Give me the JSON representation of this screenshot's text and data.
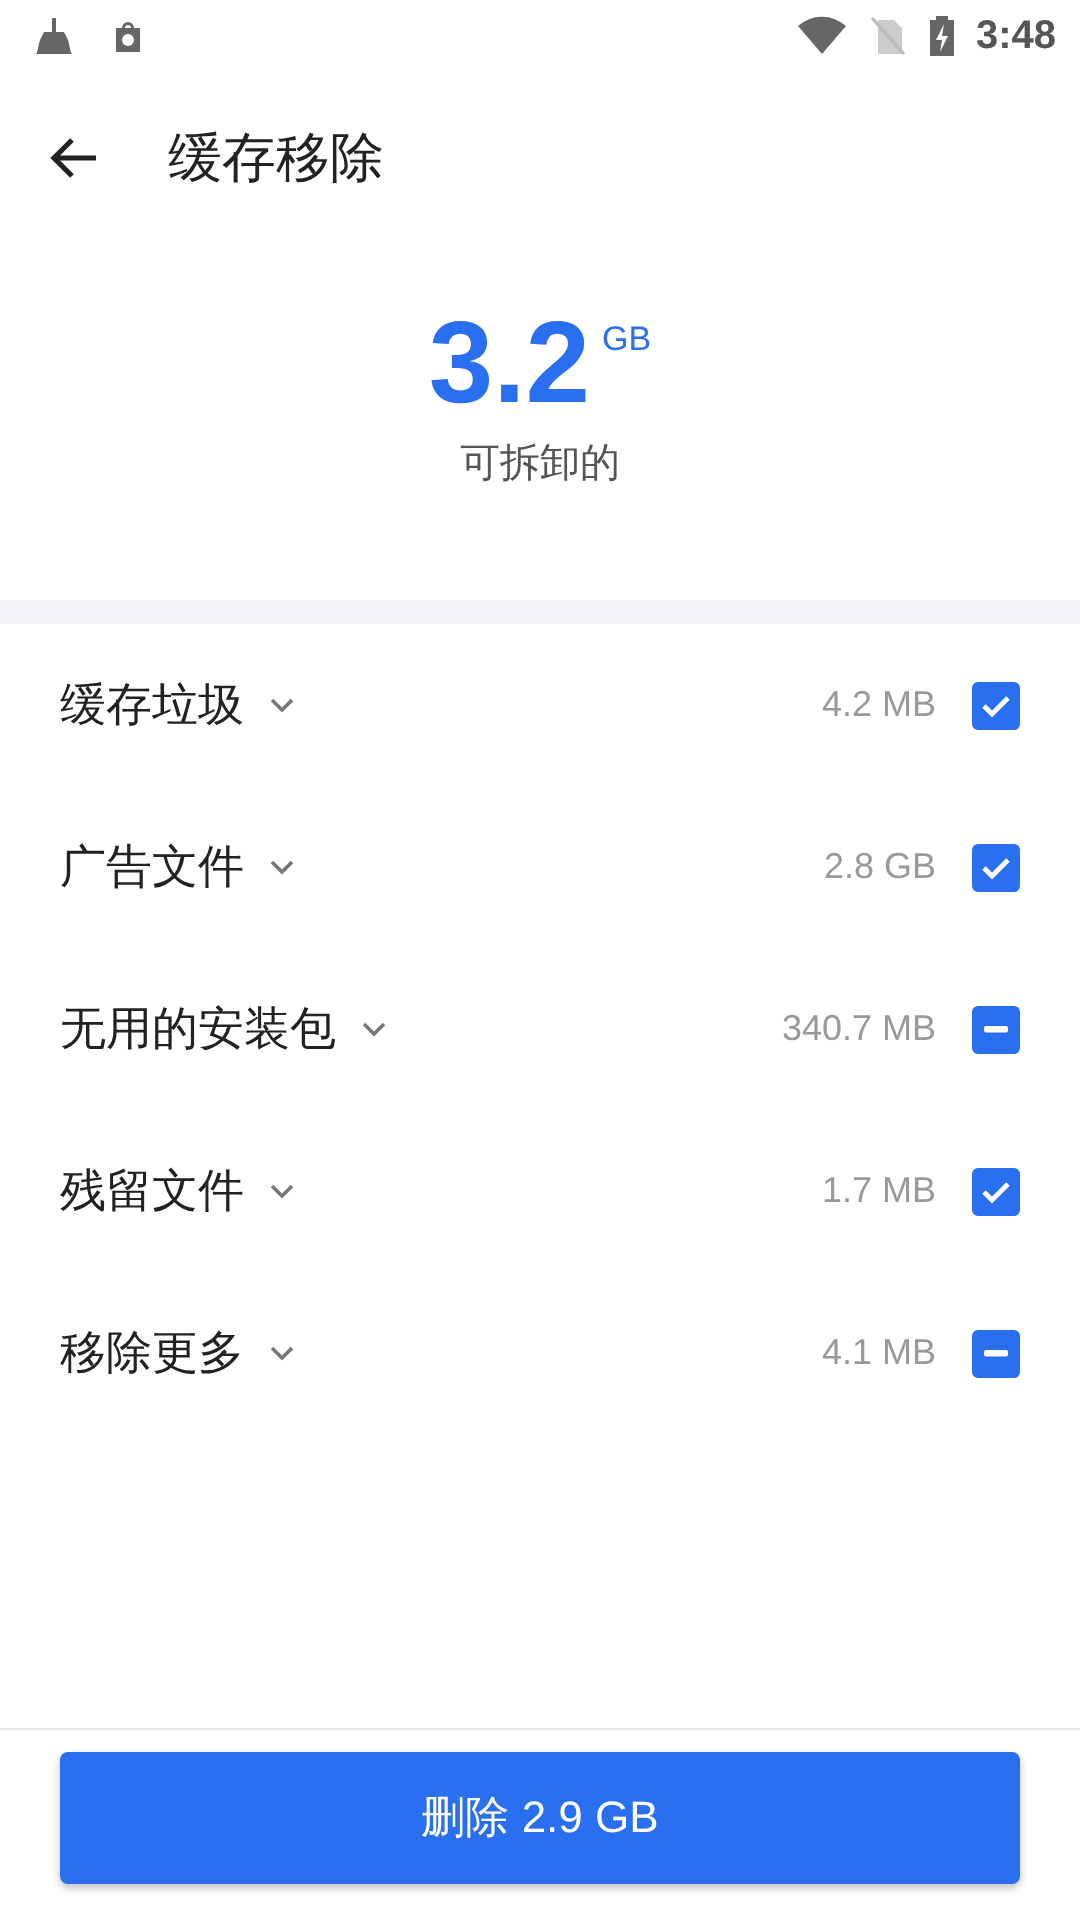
{
  "status_bar": {
    "time": "3:48"
  },
  "header": {
    "title": "缓存移除"
  },
  "summary": {
    "amount": "3.2",
    "unit": "GB",
    "caption": "可拆卸的"
  },
  "items": [
    {
      "label": "缓存垃圾",
      "size": "4.2 MB",
      "checked": true,
      "partial": false
    },
    {
      "label": "广告文件",
      "size": "2.8 GB",
      "checked": true,
      "partial": false
    },
    {
      "label": "无用的安装包",
      "size": "340.7 MB",
      "checked": true,
      "partial": true
    },
    {
      "label": "残留文件",
      "size": "1.7 MB",
      "checked": true,
      "partial": false
    },
    {
      "label": "移除更多",
      "size": "4.1 MB",
      "checked": true,
      "partial": true
    }
  ],
  "action_button": "删除 2.9 GB"
}
